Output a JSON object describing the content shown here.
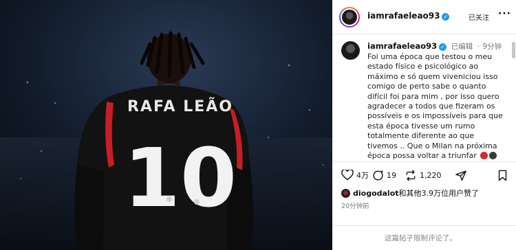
{
  "photo": {
    "jersey_name": "RAFA LEÃO",
    "jersey_number": "10"
  },
  "header": {
    "username": "iamrafaeleao93",
    "follow_label": "已关注",
    "more_label": "···"
  },
  "caption": {
    "username": "iamrafaeleao93",
    "edited": "已编辑",
    "separator": "·",
    "time": "9分钟",
    "text": "Foi uma época que testou o meu estado físico e psicológico ao máximo e só quem viveniciou isso comigo de perto sabe o quanto difícil foi para mim , por isso quero agradecer a todos que fizeram os possíveis e os impossíveis para que esta época tivesse um rumo totalmente diferente ao que tivemos .. Que o Milan na próxima época possa voltar a triunfar",
    "emoji_colors": [
      "#d62828",
      "#3a3a3a"
    ]
  },
  "actions": {
    "likes_count": "4万",
    "comments_count": "19",
    "reposts_count": "1,220"
  },
  "liked_by": {
    "user": "diogodalot",
    "rest": "和其他3.9万位用户赞了"
  },
  "post_time": "20分钟前",
  "comments_notice": "这篇帖子限制评论了。"
}
